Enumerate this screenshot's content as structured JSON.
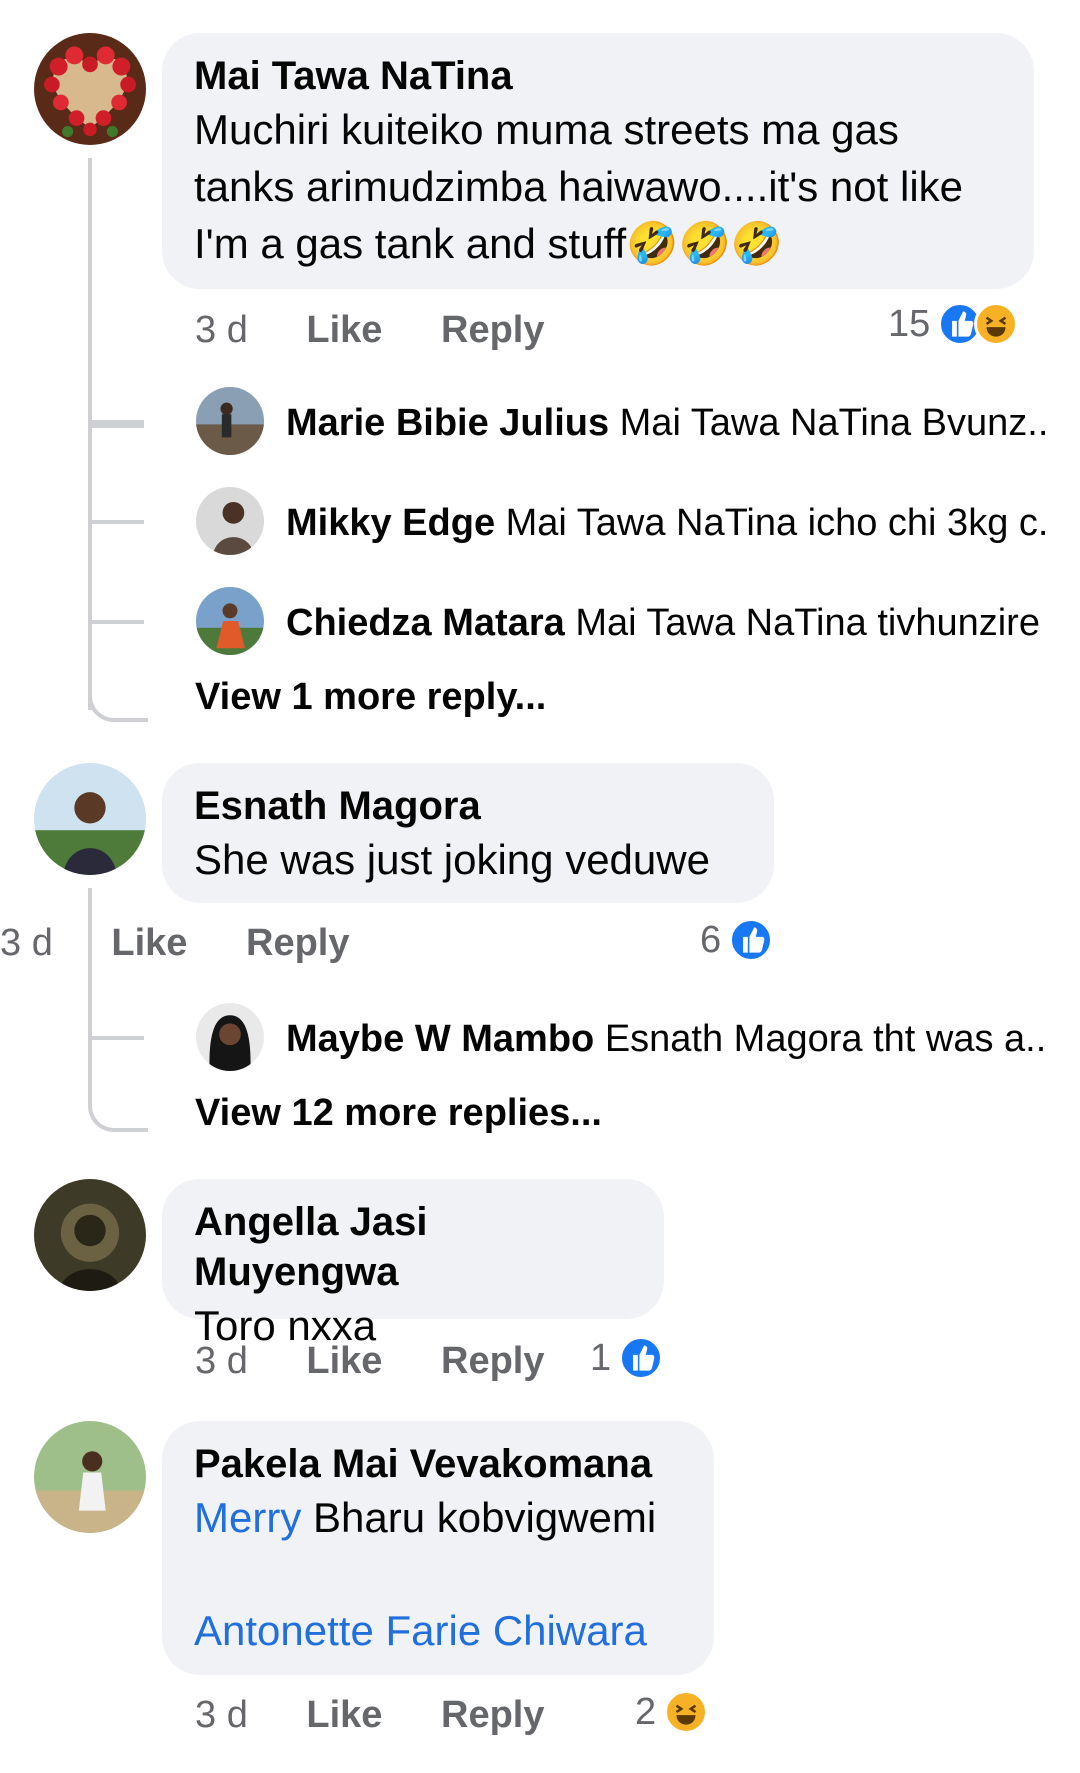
{
  "colors": {
    "mention": "#216fdb",
    "bubble": "#f0f2f5",
    "meta": "#65676b",
    "like": "#1877f2",
    "haha": "#f7b125"
  },
  "comments": [
    {
      "author": "Mai Tawa NaTina",
      "text": "Muchiri kuiteiko muma streets ma gas tanks arimudzimba haiwawo....it's not like I'm a gas tank and stuff",
      "emoji": "🤣🤣🤣",
      "time": "3 d",
      "like_label": "Like",
      "reply_label": "Reply",
      "reaction_count": "15",
      "reactions": [
        "like-icon",
        "haha-icon"
      ],
      "replies": [
        {
          "author": "Marie Bibie Julius",
          "text": "Mai Tawa NaTina Bvunz..."
        },
        {
          "author": "Mikky Edge",
          "text": "Mai Tawa NaTina icho chi 3kg c..."
        },
        {
          "author": "Chiedza Matara",
          "text": "Mai Tawa NaTina tivhunzire"
        }
      ],
      "more_replies": "View 1 more reply..."
    },
    {
      "author": "Esnath Magora",
      "text": "She was just joking veduwe",
      "time": "3 d",
      "like_label": "Like",
      "reply_label": "Reply",
      "reaction_count": "6",
      "reactions": [
        "like-icon"
      ],
      "replies": [
        {
          "author": "Maybe W Mambo",
          "text": "Esnath Magora tht was a..."
        }
      ],
      "more_replies": "View 12 more replies..."
    },
    {
      "author": "Angella Jasi Muyengwa",
      "text": "Toro nxxa",
      "time": "3 d",
      "like_label": "Like",
      "reply_label": "Reply",
      "reaction_count": "1",
      "reactions": [
        "like-icon"
      ]
    },
    {
      "author": "Pakela Mai Vevakomana",
      "mention1": "Merry",
      "text": "Bharu kobvigwemi",
      "mention2": "Antonette Farie Chiwara",
      "time": "3 d",
      "like_label": "Like",
      "reply_label": "Reply",
      "reaction_count": "2",
      "reactions": [
        "haha-icon"
      ]
    }
  ]
}
